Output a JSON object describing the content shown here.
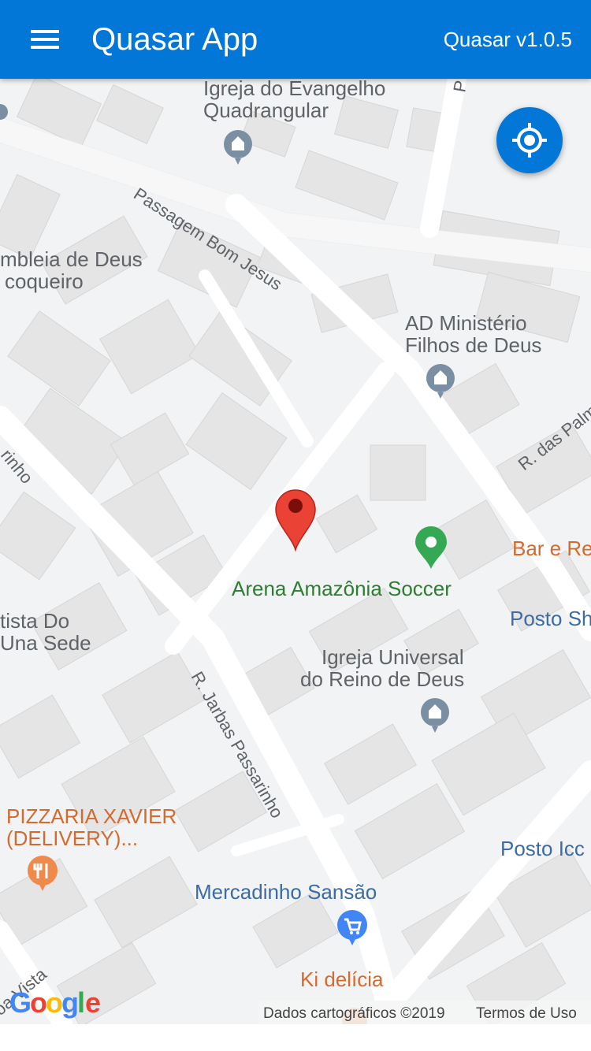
{
  "header": {
    "menu_icon": "menu-icon",
    "title": "Quasar App",
    "version": "Quasar v1.0.5"
  },
  "map": {
    "locate_icon": "my-location-icon",
    "marker_icon": "red-pin-icon",
    "places": [
      {
        "name": "Igreja do Evangelho",
        "name2": "Quadrangular",
        "icon": "church-icon"
      },
      {
        "name": "mbleia de Deus",
        "name2": "coqueiro"
      },
      {
        "name": "AD Ministério",
        "name2": "Filhos de Deus",
        "icon": "church-icon"
      },
      {
        "name": "Arena Amazônia Soccer",
        "icon": "green-place-icon"
      },
      {
        "name": "Bar e Re"
      },
      {
        "name": "tista Do",
        "name2": "Una Sede"
      },
      {
        "name": "Posto Sh"
      },
      {
        "name": "Igreja Universal",
        "name2": "do Reino de Deus",
        "icon": "church-icon"
      },
      {
        "name": "PIZZARIA XAVIER",
        "name2": "(DELIVERY)...",
        "icon": "restaurant-icon"
      },
      {
        "name": "Posto Icc"
      },
      {
        "name": "Mercadinho Sansão",
        "icon": "shopping-cart-icon"
      },
      {
        "name": "Ki delícia"
      }
    ],
    "streets": [
      "Passagem Bom Jesus",
      "R. das Palm",
      "R. Jarbas Passarinho",
      "rinho",
      "oa Vista",
      "P"
    ],
    "google_logo": "Google",
    "attribution": "Dados cartográficos ©2019",
    "terms": "Termos de Uso",
    "colors": {
      "header": "#0277d8",
      "land": "#f1f3f4",
      "building": "#e4e4e4",
      "road": "#ffffff",
      "marker": "#ea4335",
      "place_green": "#34a853",
      "place_orange": "#d46b2e",
      "label_blue": "#3b6ca5"
    }
  }
}
